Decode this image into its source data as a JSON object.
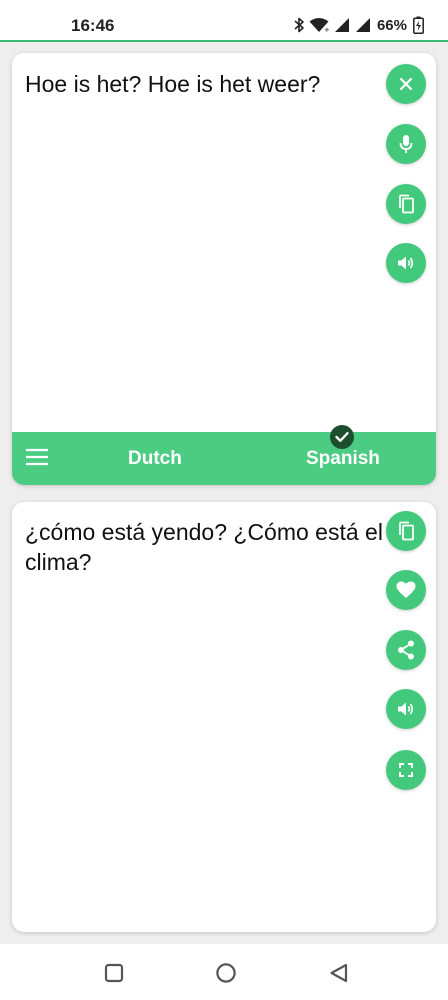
{
  "status_bar": {
    "time": "16:46",
    "battery_percent": "66%",
    "icons": [
      "bluetooth-icon",
      "wifi-icon",
      "signal-icon",
      "signal-icon",
      "battery-icon"
    ]
  },
  "source_panel": {
    "text": "Hoe is het? Hoe is het weer?",
    "actions": [
      "clear-icon",
      "microphone-icon",
      "copy-icon",
      "speaker-icon"
    ]
  },
  "language_bar": {
    "source_language": "Dutch",
    "target_language": "Spanish",
    "menu_icon": "hamburger-menu-icon",
    "selected_icon": "check-icon"
  },
  "target_panel": {
    "text": "¿cómo está yendo? ¿Cómo está el clima?",
    "actions": [
      "copy-icon",
      "heart-icon",
      "share-icon",
      "speaker-icon",
      "fullscreen-icon"
    ]
  },
  "nav_bar": {
    "buttons": [
      "recents-square-icon",
      "home-circle-icon",
      "back-triangle-icon"
    ]
  },
  "colors": {
    "accent": "#43c97b",
    "language_bar": "#4ccb82",
    "badge": "#1d4f2f",
    "background": "#eeeeee"
  }
}
